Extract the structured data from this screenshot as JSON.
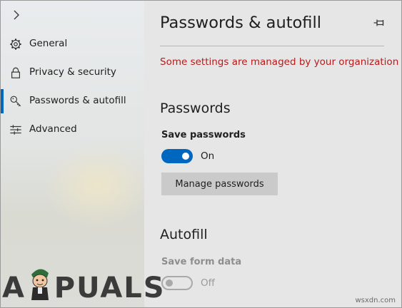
{
  "sidebar": {
    "items": [
      {
        "label": "General",
        "icon": "gear-icon"
      },
      {
        "label": "Privacy & security",
        "icon": "lock-icon"
      },
      {
        "label": "Passwords & autofill",
        "icon": "key-icon",
        "active": true
      },
      {
        "label": "Advanced",
        "icon": "sliders-icon"
      }
    ],
    "expand_icon": "chevron-right-icon"
  },
  "header": {
    "title": "Passwords & autofill",
    "pin_icon": "pin-icon"
  },
  "notice": "Some settings are managed by your organization",
  "passwords": {
    "title": "Passwords",
    "save_label": "Save passwords",
    "save_state": "On",
    "manage_button": "Manage passwords"
  },
  "autofill": {
    "title": "Autofill",
    "form_label": "Save form data",
    "form_state": "Off"
  },
  "watermarks": {
    "logo": "APPUALS",
    "site": "wsxdn.com"
  },
  "colors": {
    "accent": "#0067c0",
    "warning": "#b61c1c",
    "button": "#cacaca",
    "background": "#e6e6e6"
  }
}
